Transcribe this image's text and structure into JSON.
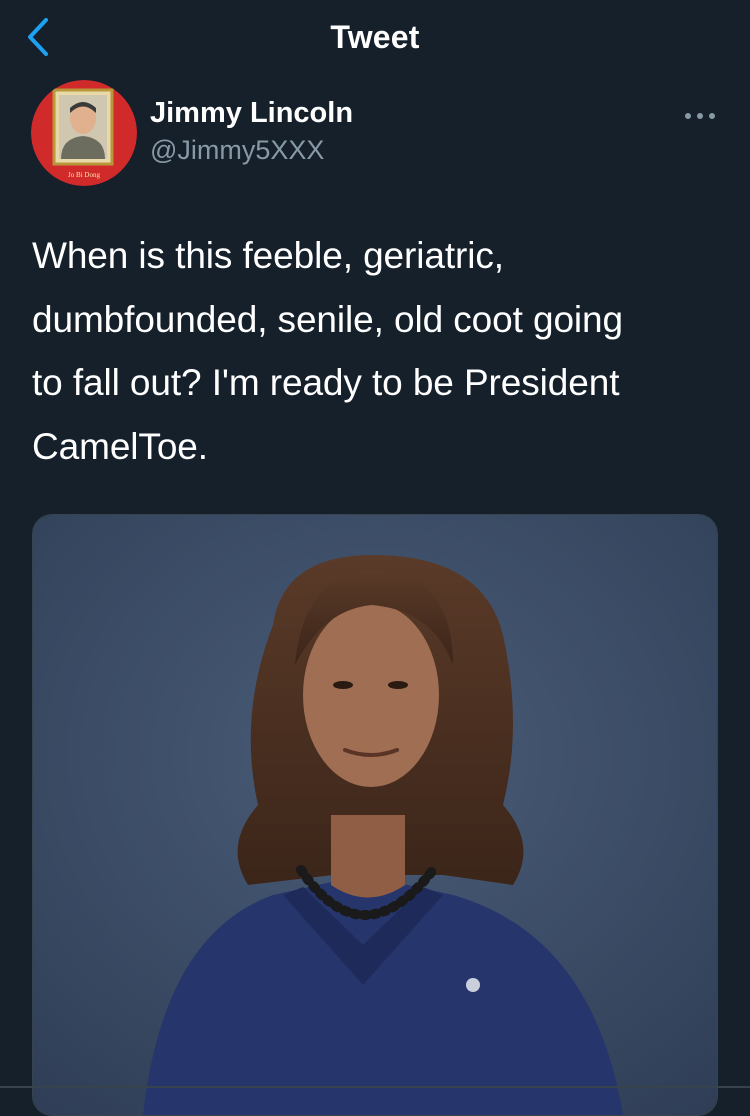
{
  "header": {
    "title": "Tweet",
    "back_icon": "chevron-left-icon",
    "accent_color": "#1da1f2"
  },
  "tweet": {
    "author": {
      "display_name": "Jimmy Lincoln",
      "handle": "@Jimmy5XXX",
      "avatar_caption": "Jo Bi Dong"
    },
    "more_icon": "ellipsis-icon",
    "text": "When is this feeble, geriatric,\ndumbfounded, senile, old coot going\nto fall out? I'm ready to be President\nCamelToe.",
    "media": {
      "type": "photo"
    }
  },
  "theme": {
    "background": "#15202b",
    "secondary_text": "#8899a6",
    "divider": "#38444d"
  }
}
